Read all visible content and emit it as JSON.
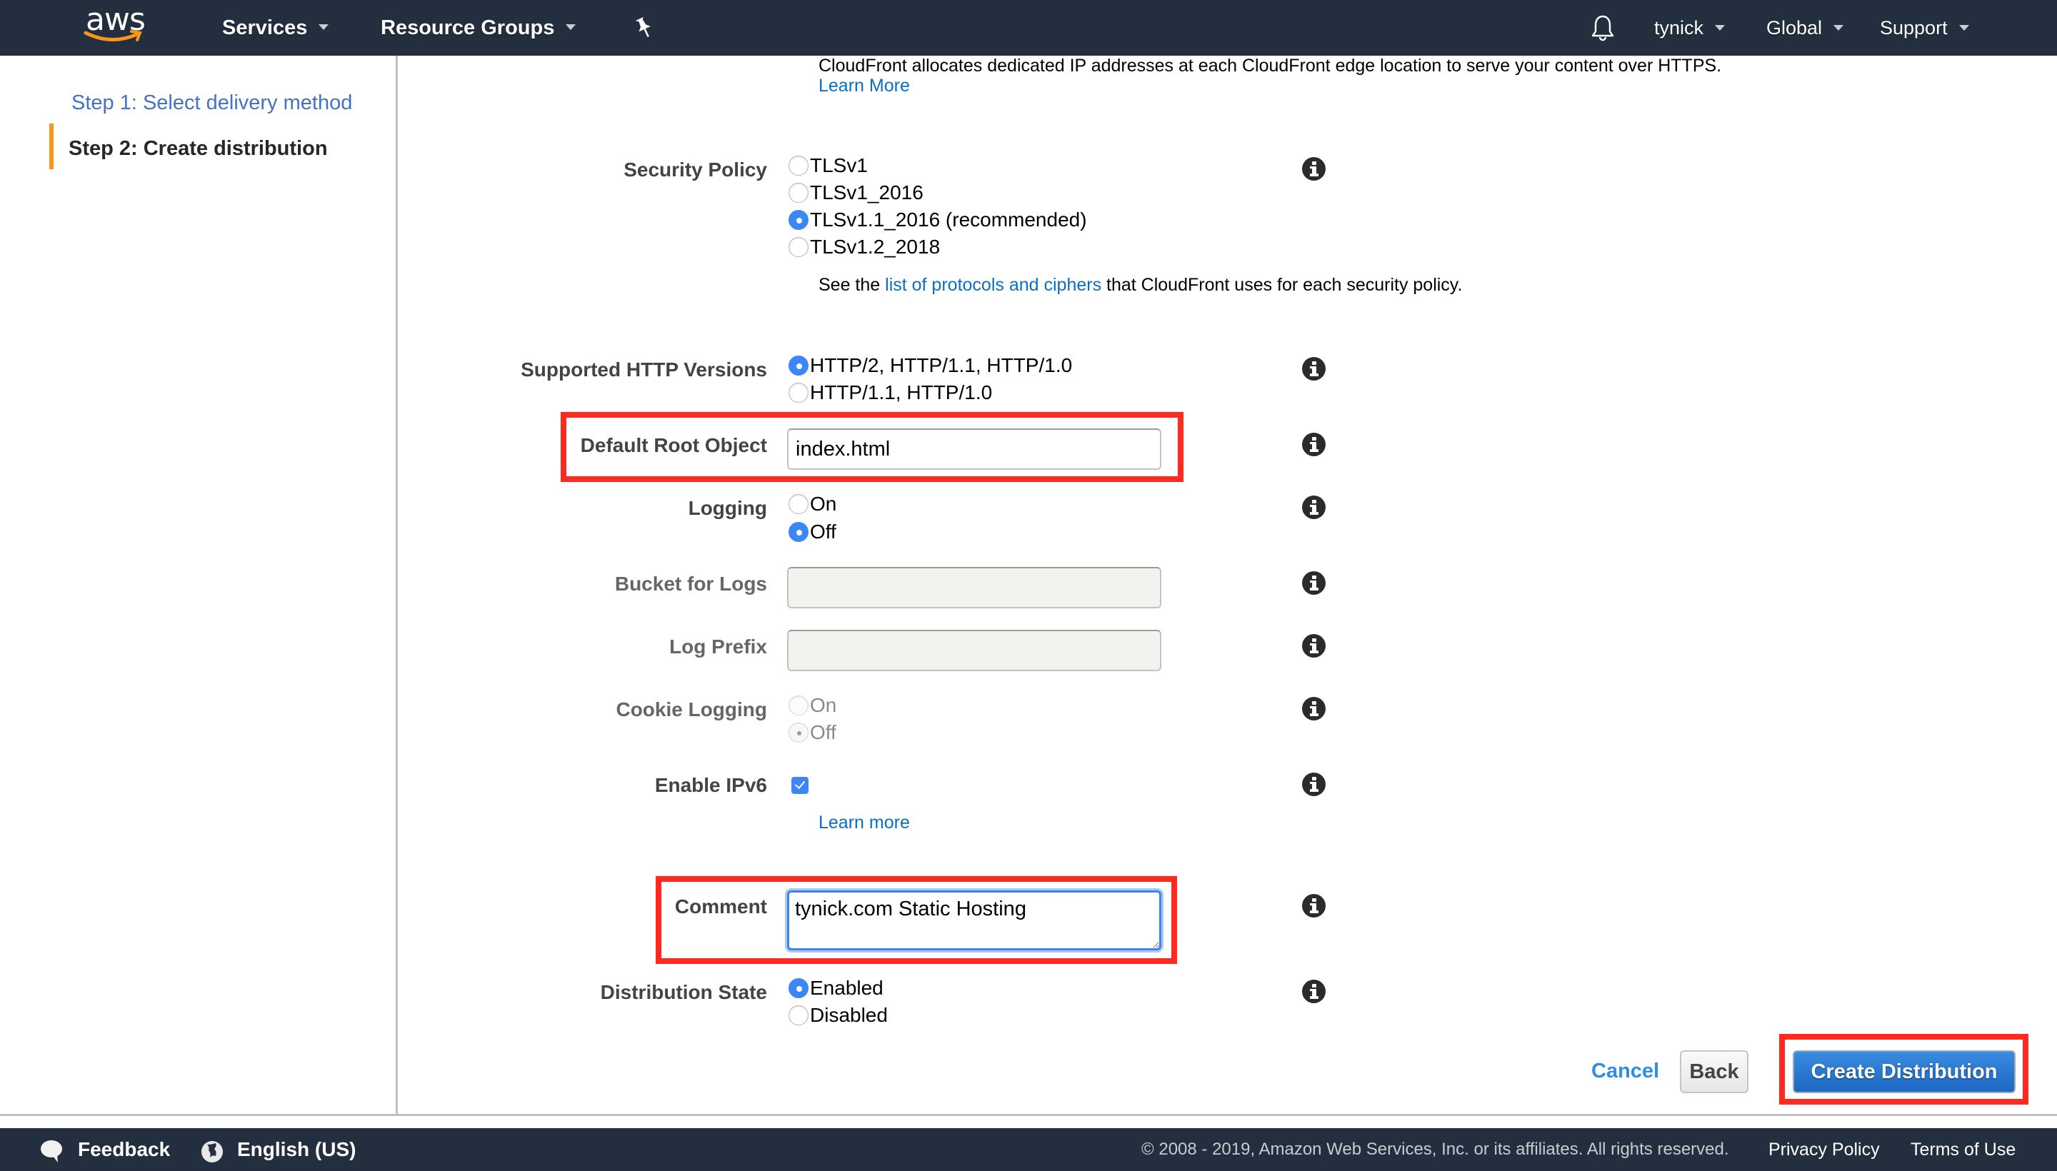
{
  "header": {
    "logo_text": "aws",
    "services_label": "Services",
    "resource_groups_label": "Resource Groups",
    "user_label": "tynick",
    "region_label": "Global",
    "support_label": "Support"
  },
  "sidebar": {
    "steps": [
      {
        "label": "Step 1: Select delivery method",
        "state": "link"
      },
      {
        "label": "Step 2: Create distribution",
        "state": "current"
      }
    ]
  },
  "form": {
    "intro_text": "CloudFront allocates dedicated IP addresses at each CloudFront edge location to serve your content over HTTPS.",
    "intro_link": "Learn More",
    "security_policy": {
      "label": "Security Policy",
      "options": [
        "TLSv1",
        "TLSv1_2016",
        "TLSv1.1_2016 (recommended)",
        "TLSv1.2_2018"
      ],
      "selected": "TLSv1.1_2016 (recommended)",
      "note_prefix": "See the ",
      "note_link": "list of protocols and ciphers",
      "note_suffix": " that CloudFront uses for each security policy."
    },
    "http_versions": {
      "label": "Supported HTTP Versions",
      "options": [
        "HTTP/2, HTTP/1.1, HTTP/1.0",
        "HTTP/1.1, HTTP/1.0"
      ],
      "selected": "HTTP/2, HTTP/1.1, HTTP/1.0"
    },
    "default_root_object": {
      "label": "Default Root Object",
      "value": "index.html"
    },
    "logging": {
      "label": "Logging",
      "options": [
        "On",
        "Off"
      ],
      "selected": "Off"
    },
    "bucket_for_logs": {
      "label": "Bucket for Logs",
      "value": ""
    },
    "log_prefix": {
      "label": "Log Prefix",
      "value": ""
    },
    "cookie_logging": {
      "label": "Cookie Logging",
      "options": [
        "On",
        "Off"
      ],
      "selected": "Off",
      "disabled": true
    },
    "enable_ipv6": {
      "label": "Enable IPv6",
      "checked": true,
      "link": "Learn more"
    },
    "comment": {
      "label": "Comment",
      "value": "tynick.com Static Hosting"
    },
    "distribution_state": {
      "label": "Distribution State",
      "options": [
        "Enabled",
        "Disabled"
      ],
      "selected": "Enabled"
    }
  },
  "actions": {
    "cancel_label": "Cancel",
    "back_label": "Back",
    "create_label": "Create Distribution"
  },
  "footer": {
    "feedback_label": "Feedback",
    "language_label": "English (US)",
    "copyright": "© 2008 - 2019, Amazon Web Services, Inc. or its affiliates. All rights reserved.",
    "privacy_label": "Privacy Policy",
    "terms_label": "Terms of Use"
  },
  "colors": {
    "nav_bg": "#232f3e",
    "accent_orange": "#f7981d",
    "link_blue": "#0b6ec5",
    "primary_button": "#1c67c2",
    "highlight_red": "#ff2a1f",
    "radio_selected": "#3b87f5"
  }
}
